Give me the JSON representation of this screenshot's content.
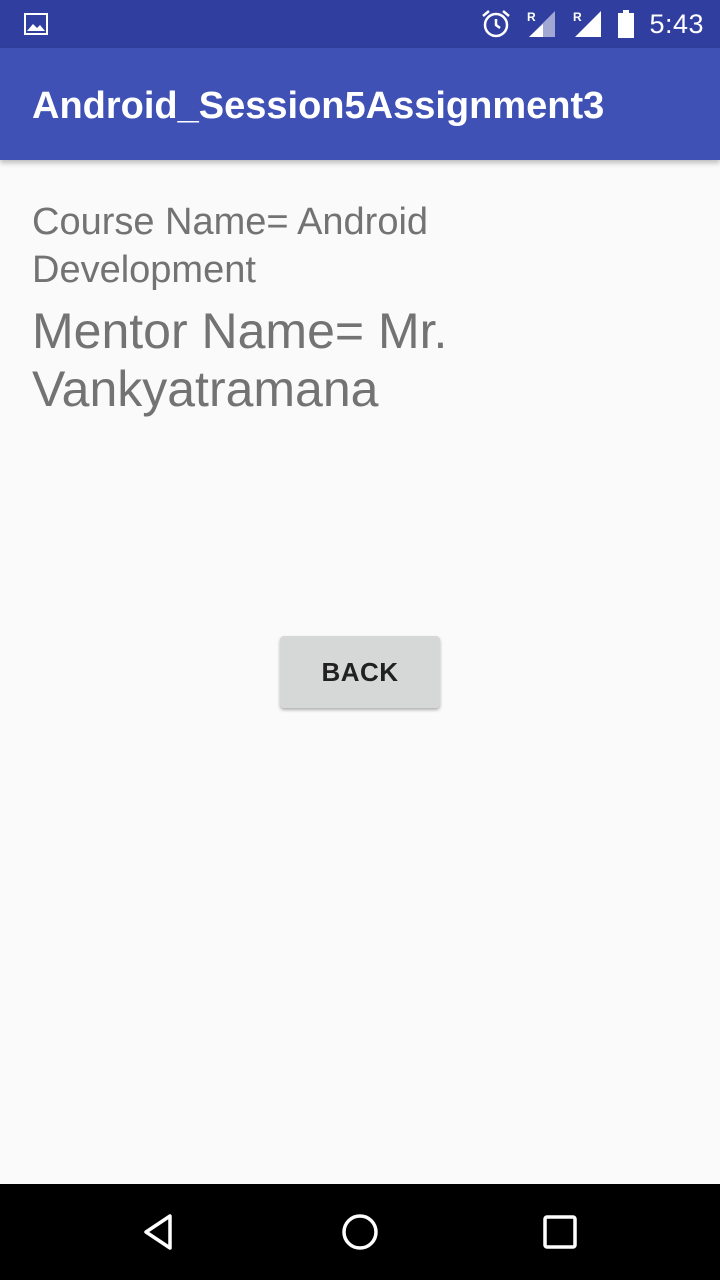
{
  "status_bar": {
    "time": "5:43",
    "icons": [
      "image-notification-icon",
      "alarm-icon",
      "signal-roaming-icon",
      "signal-roaming-icon",
      "battery-icon"
    ],
    "roaming_label": "R",
    "background": "#303f9f"
  },
  "app_bar": {
    "title": "Android_Session5Assignment3",
    "background": "#3f51b5"
  },
  "content": {
    "course_text": "Course Name= Android Development",
    "mentor_text": "Mentor Name= Mr. Vankyatramana",
    "text_color": "#737373"
  },
  "back_button": {
    "label": "BACK"
  },
  "nav_bar": {
    "icons": [
      "back-triangle-icon",
      "home-circle-icon",
      "recents-square-icon"
    ]
  }
}
